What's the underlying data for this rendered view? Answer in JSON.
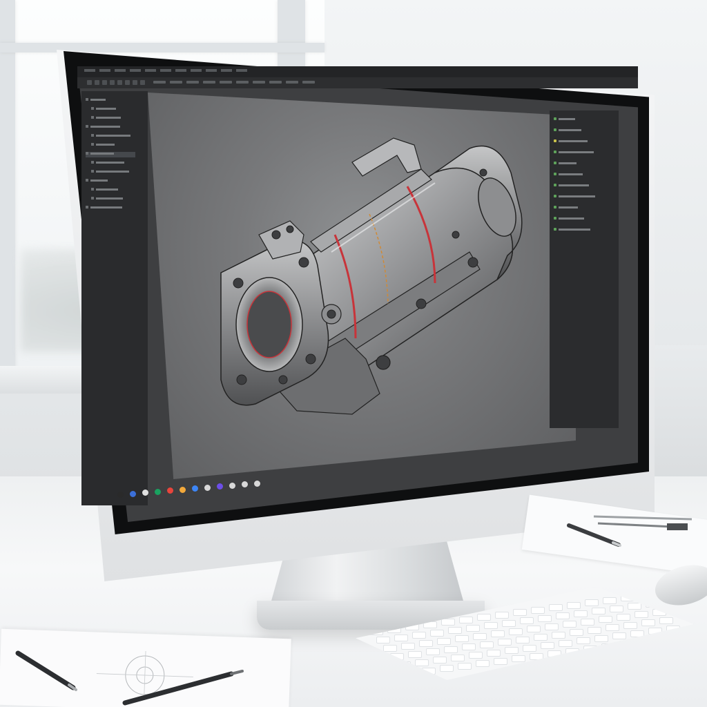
{
  "scene": {
    "desk_color": "#eef0f1",
    "screen_bg": "#3e3f41",
    "accent_red": "#c8343a"
  },
  "cad_app": {
    "menu_items": [
      "",
      "",
      "",
      "",
      "",
      "",
      "",
      "",
      "",
      "",
      ""
    ],
    "toolbar_icons": [
      "select-icon",
      "move-icon",
      "rotate-icon",
      "zoom-icon",
      "pan-icon",
      "measure-icon",
      "section-icon",
      "render-icon"
    ],
    "left_tree": [
      {
        "icon": "folder-icon"
      },
      {
        "icon": "part-icon"
      },
      {
        "icon": "part-icon"
      },
      {
        "icon": "part-icon"
      },
      {
        "icon": "part-icon"
      },
      {
        "icon": "folder-icon"
      },
      {
        "icon": "part-icon"
      },
      {
        "icon": "part-icon"
      },
      {
        "icon": "part-icon"
      },
      {
        "icon": "part-icon"
      },
      {
        "icon": "part-icon"
      },
      {
        "icon": "part-icon"
      },
      {
        "icon": "part-icon"
      }
    ],
    "right_properties": [
      {
        "icon": "property-icon"
      },
      {
        "icon": "property-icon"
      },
      {
        "icon": "property-icon"
      },
      {
        "icon": "property-icon"
      },
      {
        "icon": "property-icon"
      },
      {
        "icon": "property-icon"
      },
      {
        "icon": "property-icon"
      },
      {
        "icon": "property-icon"
      },
      {
        "icon": "property-icon"
      },
      {
        "icon": "property-icon"
      },
      {
        "icon": "property-icon"
      }
    ],
    "model": {
      "name_icon": "gearbox-housing-model-icon"
    },
    "taskbar_icons": [
      {
        "icon": "start-icon",
        "color": "#2a2a2a"
      },
      {
        "icon": "app-icon",
        "color": "#3b6fd8"
      },
      {
        "icon": "app-icon",
        "color": "#e0e0e0"
      },
      {
        "icon": "app-icon",
        "color": "#1aa260"
      },
      {
        "icon": "app-icon",
        "color": "#e8453c"
      },
      {
        "icon": "app-icon",
        "color": "#f3a93b"
      },
      {
        "icon": "app-icon",
        "color": "#3d86f6"
      },
      {
        "icon": "app-icon",
        "color": "#d8d8d8"
      },
      {
        "icon": "app-icon",
        "color": "#6c4ee8"
      },
      {
        "icon": "app-icon",
        "color": "#d8d8d8"
      },
      {
        "icon": "app-icon",
        "color": "#d8d8d8"
      },
      {
        "icon": "app-icon",
        "color": "#d8d8d8"
      }
    ]
  }
}
